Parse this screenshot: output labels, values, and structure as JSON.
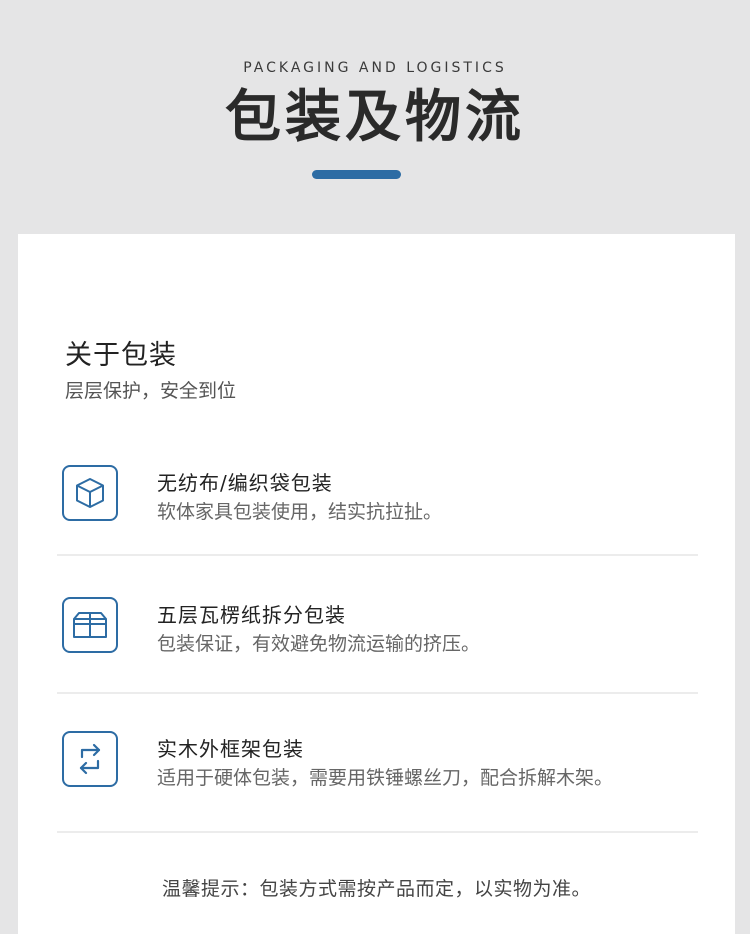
{
  "header": {
    "eyebrow": "PACKAGING AND LOGISTICS",
    "title": "包装及物流"
  },
  "section": {
    "title": "关于包装",
    "subtitle": "层层保护，安全到位"
  },
  "items": [
    {
      "icon": "box-icon",
      "title": "无纺布/编织袋包装",
      "desc": "软体家具包装使用，结实抗拉扯。"
    },
    {
      "icon": "carton-icon",
      "title": "五层瓦楞纸拆分包装",
      "desc": "包装保证，有效避免物流运输的挤压。"
    },
    {
      "icon": "exchange-arrows-icon",
      "title": "实木外框架包装",
      "desc": "适用于硬体包装，需要用铁锤螺丝刀，配合拆解木架。"
    }
  ],
  "tip": "温馨提示：包装方式需按产品而定，以实物为准。",
  "colors": {
    "accent": "#2d6ca4",
    "background": "#e5e5e6",
    "card": "#ffffff"
  }
}
